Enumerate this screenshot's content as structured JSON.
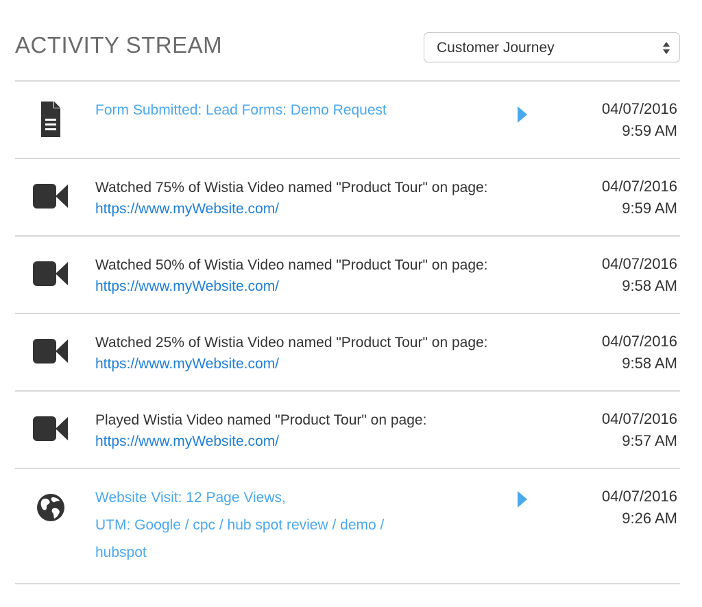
{
  "header": {
    "title": "ACTIVITY STREAM",
    "filter": {
      "selected": "Customer Journey"
    }
  },
  "activities": [
    {
      "type": "form",
      "icon": "document-icon",
      "event": "Form Submitted: Lead Forms: Demo Request",
      "date": "04/07/2016",
      "time": "9:59 AM"
    },
    {
      "type": "video",
      "icon": "video-camera-icon",
      "text": "Watched 75% of Wistia Video named \"Product Tour\" on page:",
      "url": "https://www.myWebsite.com/",
      "date": "04/07/2016",
      "time": "9:59 AM"
    },
    {
      "type": "video",
      "icon": "video-camera-icon",
      "text": "Watched 50% of Wistia Video named \"Product Tour\" on page:",
      "url": "https://www.myWebsite.com/",
      "date": "04/07/2016",
      "time": "9:58 AM"
    },
    {
      "type": "video",
      "icon": "video-camera-icon",
      "text": "Watched 25% of Wistia Video named \"Product Tour\" on page:",
      "url": "https://www.myWebsite.com/",
      "date": "04/07/2016",
      "time": "9:58 AM"
    },
    {
      "type": "video",
      "icon": "video-camera-icon",
      "text": "Played Wistia Video named \"Product Tour\" on page:",
      "url": "https://www.myWebsite.com/",
      "date": "04/07/2016",
      "time": "9:57 AM"
    },
    {
      "type": "visit",
      "icon": "globe-icon",
      "event_lines": [
        "Website Visit: 12 Page Views,",
        "UTM: Google / cpc / hub spot review / demo /",
        "hubspot"
      ],
      "date": "04/07/2016",
      "time": "9:26 AM"
    }
  ],
  "colors": {
    "event_link": "#4aa8ee",
    "url_link": "#1f7fd6",
    "expand_arrow": "#4aa8ee",
    "icon": "#333333",
    "divider": "#d9d9d9"
  }
}
